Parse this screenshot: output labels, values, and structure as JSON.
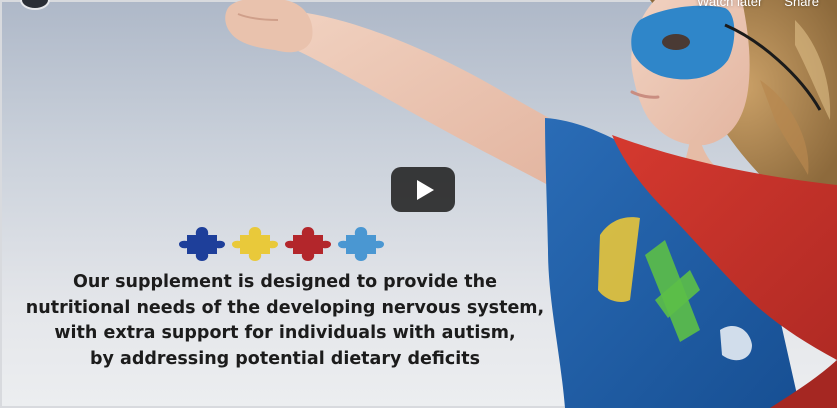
{
  "player": {
    "top_actions": [
      "Watch later",
      "Share"
    ]
  },
  "overlay": {
    "puzzle_pieces": [
      {
        "color": "#1e3f9a",
        "icon": "puzzle-piece-blue"
      },
      {
        "color": "#e9c93a",
        "icon": "puzzle-piece-yellow"
      },
      {
        "color": "#b3262b",
        "icon": "puzzle-piece-red"
      },
      {
        "color": "#4a97d2",
        "icon": "puzzle-piece-light-blue"
      }
    ],
    "caption_lines": [
      "Our supplement is designed to provide the",
      "nutritional needs of the developing nervous system,",
      "with extra support for individuals with autism,",
      "by addressing potential dietary deficits"
    ]
  },
  "colors": {
    "play_button_bg": "#212121",
    "cape": "#c8322c",
    "shirt": "#1f5fa8",
    "mask": "#2f86c9"
  }
}
